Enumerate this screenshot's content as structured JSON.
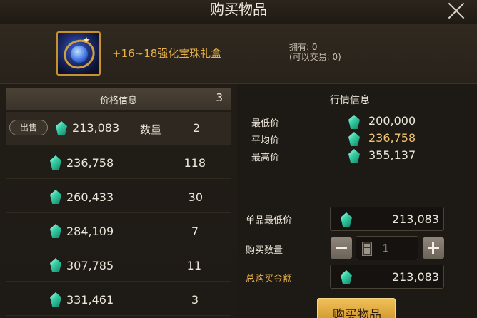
{
  "window": {
    "title": "购买物品"
  },
  "item": {
    "name": "+16~18强化宝珠礼盒",
    "owned": "拥有: 0",
    "tradable": "(可以交易: 0)"
  },
  "price_list": {
    "header": "价格信息",
    "count": "3",
    "sell_label": "出售",
    "qty_label": "数量",
    "rows": [
      {
        "price": "213,083",
        "qty": "2"
      },
      {
        "price": "236,758",
        "qty": "118"
      },
      {
        "price": "260,433",
        "qty": "30"
      },
      {
        "price": "284,109",
        "qty": "7"
      },
      {
        "price": "307,785",
        "qty": "11"
      },
      {
        "price": "331,461",
        "qty": "3"
      }
    ]
  },
  "market": {
    "title": "行情信息",
    "min_label": "最低价",
    "min_value": "200,000",
    "avg_label": "平均价",
    "avg_value": "236,758",
    "max_label": "最高价",
    "max_value": "355,137"
  },
  "purchase": {
    "unit_min_label": "单品最低价",
    "unit_min_value": "213,083",
    "qty_label": "购买数量",
    "qty_value": "1",
    "total_label": "总购买金额",
    "total_value": "213,083",
    "buy_label": "购买物品"
  },
  "colors": {
    "accent": "#e8b04a",
    "gem": "#38d2a8",
    "buy_button": "#e0a838"
  }
}
